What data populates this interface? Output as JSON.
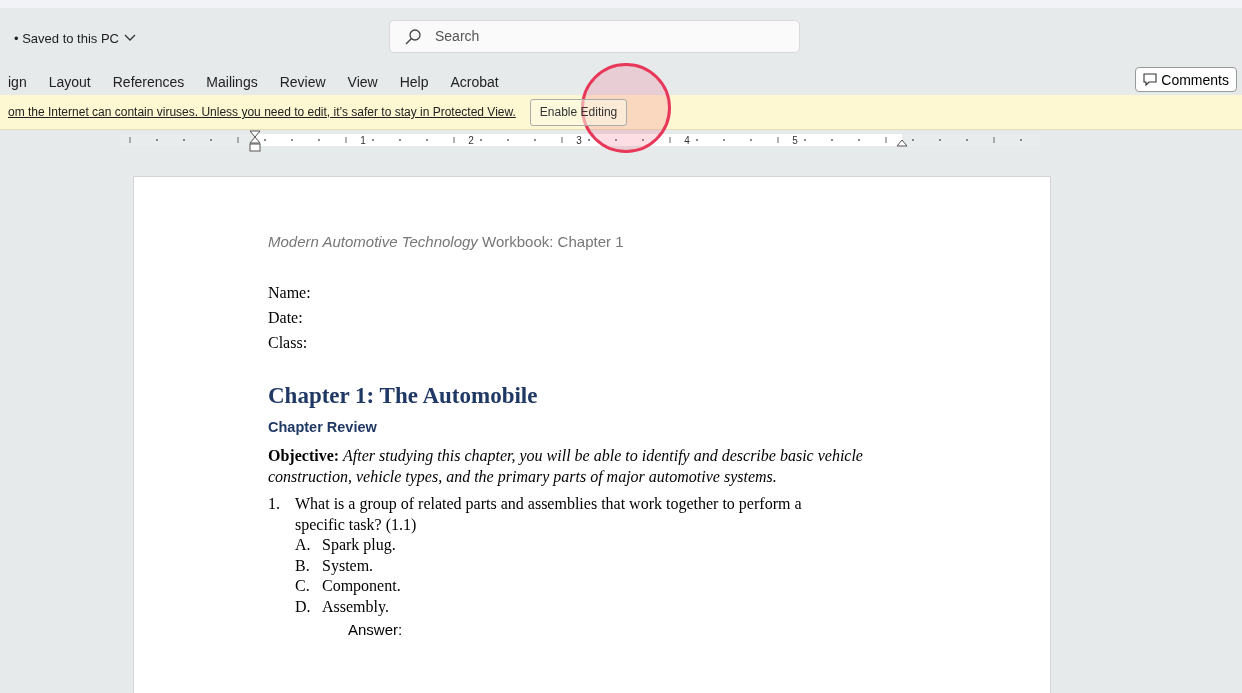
{
  "title_bar": {
    "save_status": "• Saved to this PC",
    "search": {
      "placeholder": "Search"
    }
  },
  "ribbon": {
    "tabs": [
      {
        "label": "ign",
        "selected": false
      },
      {
        "label": "Layout",
        "selected": false
      },
      {
        "label": "References",
        "selected": false
      },
      {
        "label": "Mailings",
        "selected": false
      },
      {
        "label": "Review",
        "selected": false
      },
      {
        "label": "View",
        "selected": false
      },
      {
        "label": "Help",
        "selected": false
      },
      {
        "label": "Acrobat",
        "selected": false
      }
    ],
    "comments_button": "Comments"
  },
  "message_bar": {
    "text": "om the Internet can contain viruses. Unless you need to edit, it’s safer to stay in Protected View.",
    "button": "Enable Editing"
  },
  "ruler": {
    "numbers": [
      "1",
      "2",
      "3",
      "4",
      "5"
    ]
  },
  "document": {
    "header": {
      "title": "Modern Automotive Technology",
      "rest": "Workbook: Chapter 1"
    },
    "fields": [
      "Name:",
      "Date:",
      "Class:"
    ],
    "heading": "Chapter 1: The Automobile",
    "subheading": "Chapter Review",
    "objective": "**Objective:** *After studying this chapter, you will be able to identify and describe basic vehicle construction, vehicle types, and the primary parts of major automotive systems.*",
    "questions": [
      {
        "number": "1.",
        "text": "What is a group of related parts and assemblies that work together to perform a specific task? (1.1)",
        "options": [
          {
            "letter": "A.",
            "text": "Spark plug."
          },
          {
            "letter": "B.",
            "text": "System."
          },
          {
            "letter": "C.",
            "text": "Component."
          },
          {
            "letter": "D.",
            "text": "Assembly."
          }
        ],
        "answer_label": "Answer:"
      }
    ]
  }
}
